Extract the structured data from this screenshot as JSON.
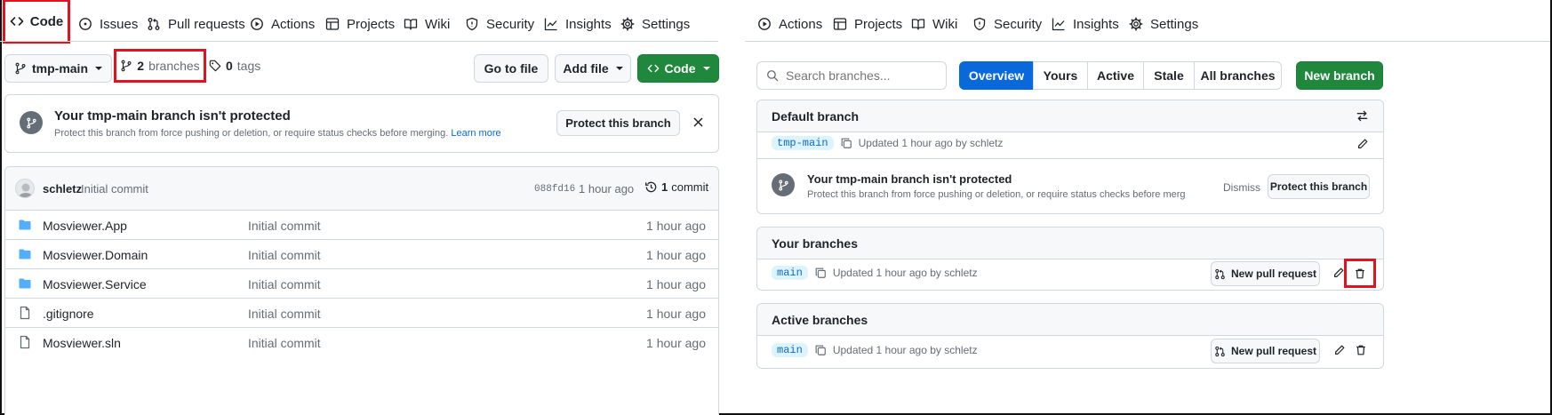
{
  "left_nav": {
    "tabs": [
      {
        "label": "Code",
        "icon": "code-icon"
      },
      {
        "label": "Issues",
        "icon": "issue-icon"
      },
      {
        "label": "Pull requests",
        "icon": "pull-request-icon"
      },
      {
        "label": "Actions",
        "icon": "play-icon"
      },
      {
        "label": "Projects",
        "icon": "table-icon"
      },
      {
        "label": "Wiki",
        "icon": "book-icon"
      },
      {
        "label": "Security",
        "icon": "shield-icon"
      },
      {
        "label": "Insights",
        "icon": "graph-icon"
      },
      {
        "label": "Settings",
        "icon": "gear-icon"
      }
    ]
  },
  "right_nav": {
    "tabs": [
      {
        "label": "Actions",
        "icon": "play-icon"
      },
      {
        "label": "Projects",
        "icon": "table-icon"
      },
      {
        "label": "Wiki",
        "icon": "book-icon"
      },
      {
        "label": "Security",
        "icon": "shield-icon"
      },
      {
        "label": "Insights",
        "icon": "graph-icon"
      },
      {
        "label": "Settings",
        "icon": "gear-icon"
      }
    ]
  },
  "repo_toolbar": {
    "branch_selector": "tmp-main",
    "branches_count": "2",
    "branches_label": "branches",
    "tags_count": "0",
    "tags_label": "tags",
    "go_to_file": "Go to file",
    "add_file": "Add file",
    "code_button": "Code"
  },
  "protect_banner": {
    "title": "Your tmp-main branch isn't protected",
    "description": "Protect this branch from force pushing or deletion, or require status checks before merging.",
    "learn_more": "Learn more",
    "button": "Protect this branch"
  },
  "commit_header": {
    "author": "schletz",
    "message": "Initial commit",
    "sha": "088fd16",
    "time": "1 hour ago",
    "commit_count": "1",
    "commit_label": "commit"
  },
  "files": [
    {
      "name": "Mosviewer.App",
      "type": "folder",
      "message": "Initial commit",
      "time": "1 hour ago"
    },
    {
      "name": "Mosviewer.Domain",
      "type": "folder",
      "message": "Initial commit",
      "time": "1 hour ago"
    },
    {
      "name": "Mosviewer.Service",
      "type": "folder",
      "message": "Initial commit",
      "time": "1 hour ago"
    },
    {
      "name": ".gitignore",
      "type": "file",
      "message": "Initial commit",
      "time": "1 hour ago"
    },
    {
      "name": "Mosviewer.sln",
      "type": "file",
      "message": "Initial commit",
      "time": "1 hour ago"
    }
  ],
  "branches_page": {
    "search_placeholder": "Search branches...",
    "filters": [
      "Overview",
      "Yours",
      "Active",
      "Stale",
      "All branches"
    ],
    "active_filter": "Overview",
    "new_branch": "New branch",
    "default_section": {
      "title": "Default branch",
      "branch": "tmp-main",
      "updated": "Updated 1 hour ago by schletz",
      "warning_title": "Your tmp-main branch isn't protected",
      "warning_desc": "Protect this branch from force pushing or deletion, or require status checks before merg",
      "dismiss": "Dismiss",
      "protect_button": "Protect this branch"
    },
    "your_section": {
      "title": "Your branches",
      "branch": "main",
      "updated": "Updated 1 hour ago by schletz",
      "new_pr": "New pull request"
    },
    "active_section": {
      "title": "Active branches",
      "branch": "main",
      "updated": "Updated 1 hour ago by schletz",
      "new_pr": "New pull request"
    }
  },
  "colors": {
    "accent_blue": "#0969da",
    "green": "#1f883d",
    "highlight_red": "#e0141e"
  }
}
